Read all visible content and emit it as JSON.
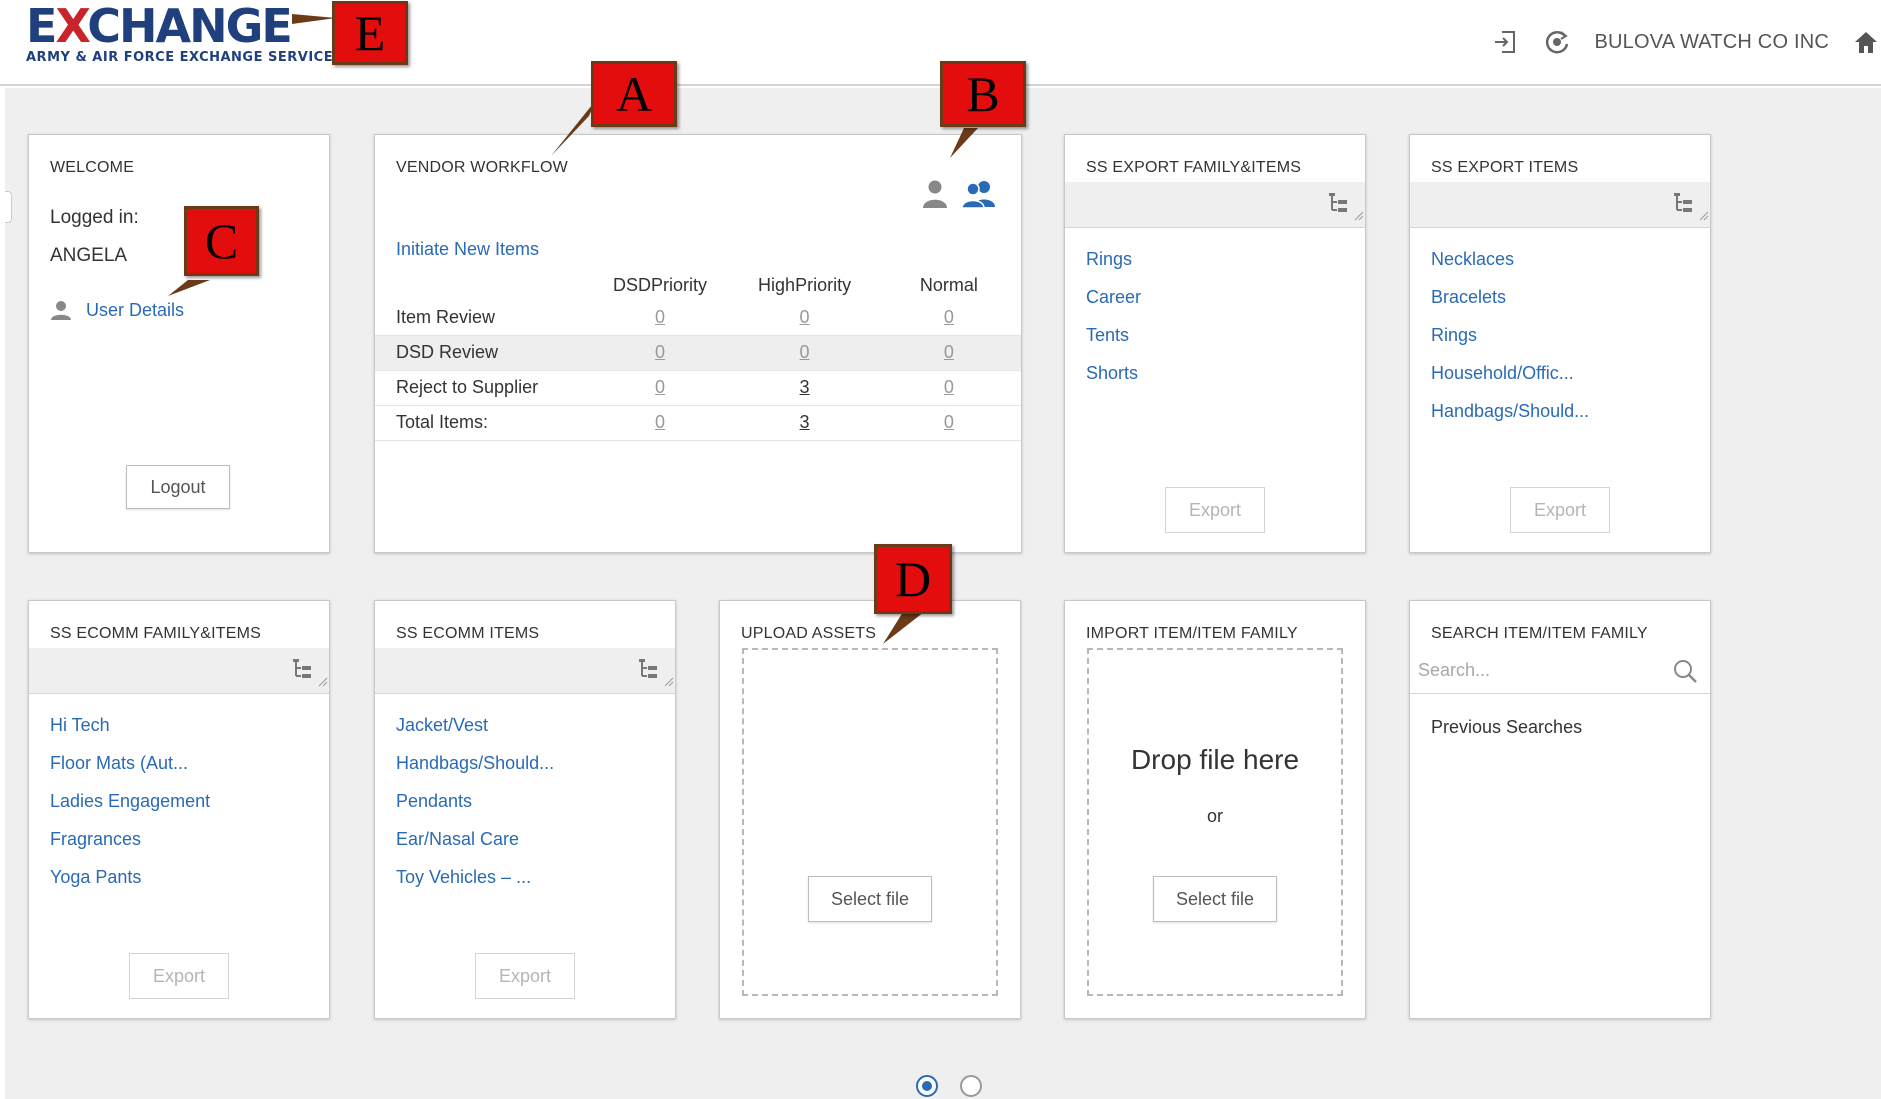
{
  "header": {
    "logo_main_pre": "E",
    "logo_main_x": "X",
    "logo_main_post": "CHANGE",
    "logo_sub": "ARMY & AIR FORCE EXCHANGE SERVICE",
    "company": "BULOVA WATCH CO INC"
  },
  "welcome": {
    "title": "WELCOME",
    "logged_in_label": "Logged in:",
    "user_name": "ANGELA",
    "user_details": "User Details",
    "logout": "Logout"
  },
  "workflow": {
    "title": "VENDOR WORKFLOW",
    "initiate": "Initiate New Items",
    "columns": [
      "DSDPriority",
      "HighPriority",
      "Normal"
    ],
    "rows": [
      {
        "label": "Item Review",
        "values": [
          "0",
          "0",
          "0"
        ]
      },
      {
        "label": "DSD Review",
        "values": [
          "0",
          "0",
          "0"
        ]
      },
      {
        "label": "Reject to Supplier",
        "values": [
          "0",
          "3",
          "0"
        ]
      },
      {
        "label": "Total Items:",
        "values": [
          "0",
          "3",
          "0"
        ]
      }
    ]
  },
  "ss_export_family": {
    "title": "SS EXPORT FAMILY&ITEMS",
    "items": [
      "Rings",
      "Career",
      "Tents",
      "Shorts"
    ],
    "export": "Export"
  },
  "ss_export_items": {
    "title": "SS EXPORT ITEMS",
    "items": [
      "Necklaces",
      "Bracelets",
      "Rings",
      "Household/Offic...",
      "Handbags/Should..."
    ],
    "export": "Export"
  },
  "ss_ecomm_family": {
    "title": "SS ECOMM FAMILY&ITEMS",
    "items": [
      "Hi Tech",
      "Floor Mats (Aut...",
      "Ladies Engagement",
      "Fragrances",
      "Yoga Pants"
    ],
    "export": "Export"
  },
  "ss_ecomm_items": {
    "title": "SS ECOMM ITEMS",
    "items": [
      "Jacket/Vest",
      "Handbags/Should...",
      "Pendants",
      "Ear/Nasal Care",
      "Toy Vehicles – ..."
    ],
    "export": "Export"
  },
  "upload_assets": {
    "title": "UPLOAD ASSETS",
    "select_file": "Select file"
  },
  "import_item": {
    "title": "IMPORT ITEM/ITEM FAMILY",
    "drop_text": "Drop file here",
    "or_text": "or",
    "select_file": "Select file"
  },
  "search_item": {
    "title": "SEARCH ITEM/ITEM FAMILY",
    "placeholder": "Search...",
    "previous": "Previous Searches"
  },
  "callouts": {
    "a": "A",
    "b": "B",
    "c": "C",
    "d": "D",
    "e": "E"
  },
  "icons": {
    "logout": "logout-icon",
    "refresh": "refresh-icon",
    "home": "home-icon",
    "user": "user-icon",
    "users": "users-icon",
    "tree": "tree-icon",
    "search": "search-icon"
  },
  "colors": {
    "brand_blue": "#1f3f7d",
    "brand_red": "#c9242b",
    "link": "#2a6ab5",
    "callout": "#e30d0d"
  },
  "pager": {
    "pages": 2,
    "active": 1
  }
}
